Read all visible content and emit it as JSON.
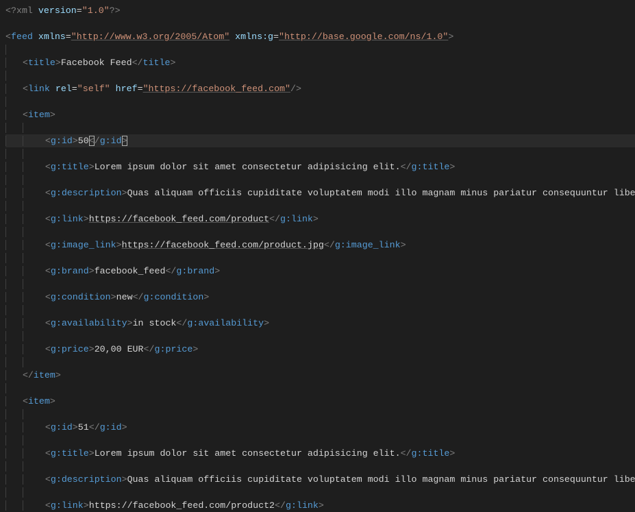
{
  "xml_decl": {
    "open": "<?",
    "name": "xml",
    "attr_version": "version",
    "version": "\"1.0\"",
    "close": "?>"
  },
  "feed": {
    "open_lt": "<",
    "name": "feed",
    "attr_xmlns": "xmlns",
    "xmlns_val": "\"http://www.w3.org/2005/Atom\"",
    "attr_xmlnsg": "xmlns:g",
    "xmlnsg_val": "\"http://base.google.com/ns/1.0\"",
    "gt": ">"
  },
  "title_tag": {
    "open": "<title>",
    "text": "Facebook Feed",
    "close": "</title>"
  },
  "link_tag": {
    "open": "<link ",
    "rel_attr": "rel",
    "rel_val": "\"self\"",
    "href_attr": "href",
    "href_val": "\"https://facebook_feed.com\"",
    "close": "/>"
  },
  "item1": {
    "open": "<item>",
    "close": "</item>",
    "g_id": {
      "open": "<g:id>",
      "val": "50",
      "close": "</g:id>"
    },
    "g_title": {
      "open": "<g:title>",
      "val": "Lorem ipsum dolor sit amet consectetur adipisicing elit.",
      "close": "</g:title>"
    },
    "g_desc": {
      "open": "<g:description>",
      "val": "Quas aliquam officiis cupiditate voluptatem modi illo magnam minus pariatur consequuntur libero,"
    },
    "g_link": {
      "open": "<g:link>",
      "val": "https://facebook_feed.com/product",
      "close": "</g:link>"
    },
    "g_image_link": {
      "open": "<g:image_link>",
      "val": "https://facebook_feed.com/product.jpg",
      "close": "</g:image_link>"
    },
    "g_brand": {
      "open": "<g:brand>",
      "val": "facebook_feed",
      "close": "</g:brand>"
    },
    "g_condition": {
      "open": "<g:condition>",
      "val": "new",
      "close": "</g:condition>"
    },
    "g_availability": {
      "open": "<g:availability>",
      "val": "in stock",
      "close": "</g:availability>"
    },
    "g_price": {
      "open": "<g:price>",
      "val": "20,00 EUR",
      "close": "</g:price>"
    }
  },
  "item2": {
    "open": "<item>",
    "g_id": {
      "open": "<g:id>",
      "val": "51",
      "close": "</g:id>"
    },
    "g_title": {
      "open": "<g:title>",
      "val": "Lorem ipsum dolor sit amet consectetur adipisicing elit.",
      "close": "</g:title>"
    },
    "g_desc": {
      "open": "<g:description>",
      "val": "Quas aliquam officiis cupiditate voluptatem modi illo magnam minus pariatur consequuntur libero,"
    },
    "g_link": {
      "open": "<g:link>",
      "val": "https://facebook_feed.com/product2",
      "close": "</g:link>"
    }
  },
  "indent": {
    "lvl1": "   ",
    "lvl2": "       "
  }
}
